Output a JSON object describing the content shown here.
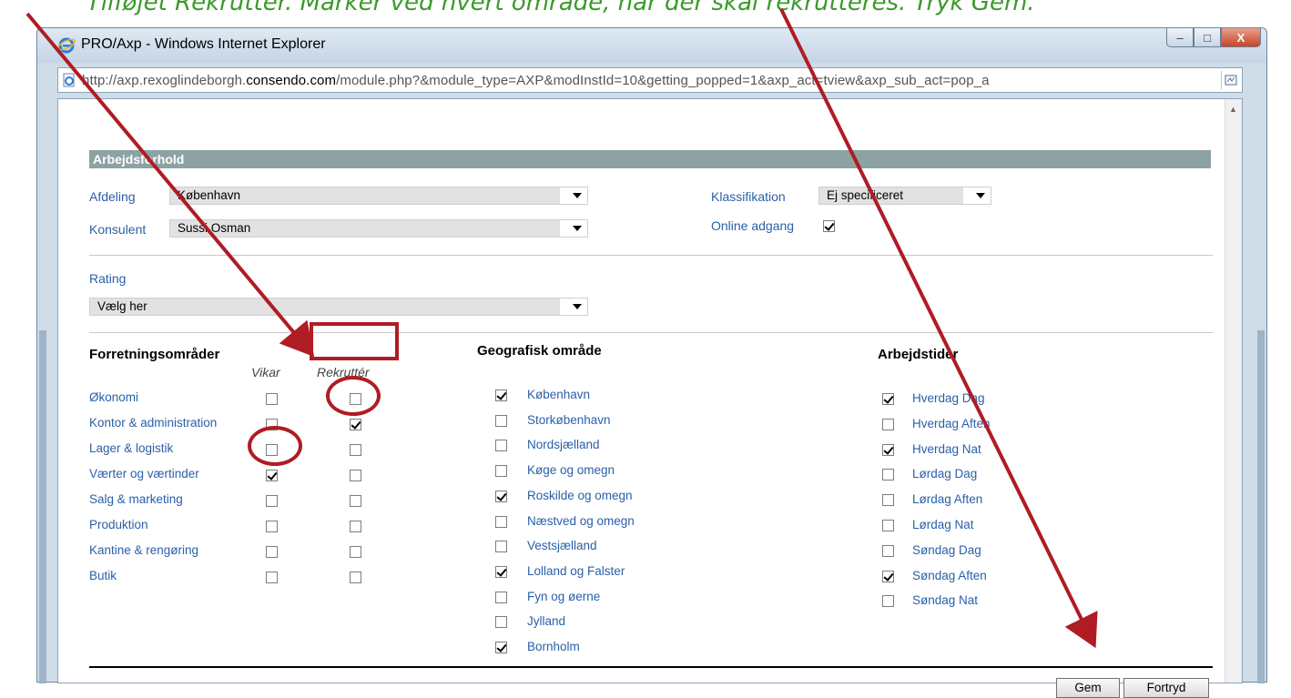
{
  "annotation": {
    "text": "Tilføjet Rekrutter. Marker ved hvert område, når der skal rekrutteres. Tryk Gem.",
    "color": "#3a9a2a"
  },
  "window": {
    "title": "PRO/Axp - Windows Internet Explorer",
    "url_prefix": "http://axp.rexoglindeborgh.",
    "url_domain": "consendo.com",
    "url_suffix": "/module.php?&module_type=AXP&modInstId=10&getting_popped=1&axp_act=tview&axp_sub_act=pop_a",
    "buttons": {
      "minimize": "–",
      "maximize": "□",
      "close": "X"
    }
  },
  "form": {
    "section_title": "Arbejdsforhold",
    "afdeling": {
      "label": "Afdeling",
      "value": "København"
    },
    "konsulent": {
      "label": "Konsulent",
      "value": "Sussi Osman"
    },
    "klassifikation": {
      "label": "Klassifikation",
      "value": "Ej specificeret"
    },
    "online_adgang": {
      "label": "Online adgang",
      "checked": true
    },
    "rating": {
      "label": "Rating",
      "value": "Vælg her"
    },
    "forretning": {
      "title": "Forretningsområder",
      "col_vikar": "Vikar",
      "col_rekrutter": "Rekruttér",
      "items": [
        {
          "label": "Økonomi",
          "vikar": false,
          "rekrutter": false
        },
        {
          "label": "Kontor & administration",
          "vikar": false,
          "rekrutter": true
        },
        {
          "label": "Lager & logistik",
          "vikar": false,
          "rekrutter": false
        },
        {
          "label": "Værter og værtinder",
          "vikar": true,
          "rekrutter": false
        },
        {
          "label": "Salg & marketing",
          "vikar": false,
          "rekrutter": false
        },
        {
          "label": "Produktion",
          "vikar": false,
          "rekrutter": false
        },
        {
          "label": "Kantine & rengøring",
          "vikar": false,
          "rekrutter": false
        },
        {
          "label": "Butik",
          "vikar": false,
          "rekrutter": false
        }
      ]
    },
    "geografi": {
      "title": "Geografisk område",
      "items": [
        {
          "label": "København",
          "checked": true
        },
        {
          "label": "Storkøbenhavn",
          "checked": false
        },
        {
          "label": "Nordsjælland",
          "checked": false
        },
        {
          "label": "Køge og omegn",
          "checked": false
        },
        {
          "label": "Roskilde og omegn",
          "checked": true
        },
        {
          "label": "Næstved og omegn",
          "checked": false
        },
        {
          "label": "Vestsjælland",
          "checked": false
        },
        {
          "label": "Lolland og Falster",
          "checked": true
        },
        {
          "label": "Fyn og øerne",
          "checked": false
        },
        {
          "label": "Jylland",
          "checked": false
        },
        {
          "label": "Bornholm",
          "checked": true
        }
      ]
    },
    "arbejdstider": {
      "title": "Arbejdstider",
      "items": [
        {
          "label": "Hverdag Dag",
          "checked": true
        },
        {
          "label": "Hverdag Aften",
          "checked": false
        },
        {
          "label": "Hverdag Nat",
          "checked": true
        },
        {
          "label": "Lørdag Dag",
          "checked": false
        },
        {
          "label": "Lørdag Aften",
          "checked": false
        },
        {
          "label": "Lørdag Nat",
          "checked": false
        },
        {
          "label": "Søndag Dag",
          "checked": false
        },
        {
          "label": "Søndag Aften",
          "checked": true
        },
        {
          "label": "Søndag Nat",
          "checked": false
        }
      ]
    },
    "buttons": {
      "save": "Gem",
      "cancel": "Fortryd"
    }
  },
  "colors": {
    "highlight": "#b01c24",
    "section_header": "#8da2a3",
    "link": "#2a5fa8"
  }
}
